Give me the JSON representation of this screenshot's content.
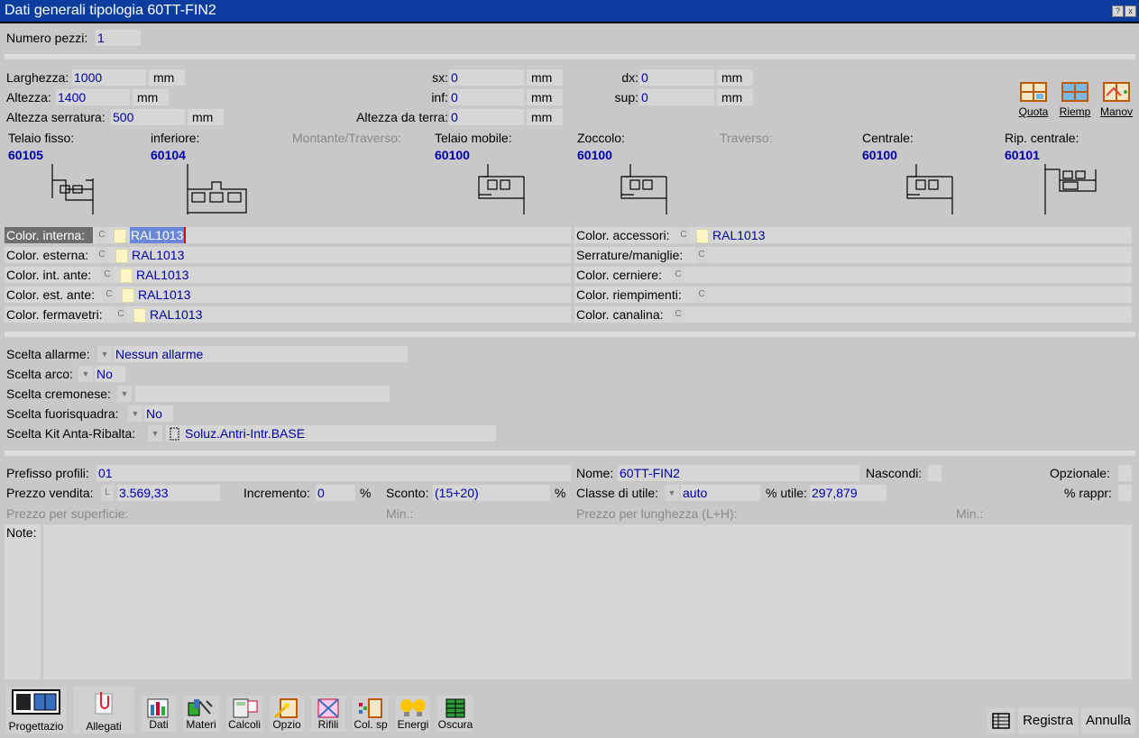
{
  "window": {
    "title": "Dati generali tipologia 60TT-FIN2",
    "help_btn": "?",
    "close_btn": "x"
  },
  "pezzi": {
    "label": "Numero pezzi:",
    "value": "1"
  },
  "dims": {
    "larghezza_label": "Larghezza:",
    "larghezza": "1000",
    "larghezza_unit": "mm",
    "altezza_label": "Altezza:",
    "altezza": "1400",
    "altezza_unit": "mm",
    "serratura_label": "Altezza serratura:",
    "serratura": "500",
    "serratura_unit": "mm",
    "sx_label": "sx:",
    "sx": "0",
    "sx_unit": "mm",
    "inf_label": "inf:",
    "inf": "0",
    "inf_unit": "mm",
    "terra_label": "Altezza da terra:",
    "terra": "0",
    "terra_unit": "mm",
    "dx_label": "dx:",
    "dx": "0",
    "dx_unit": "mm",
    "sup_label": "sup:",
    "sup": "0",
    "sup_unit": "mm"
  },
  "side_buttons": {
    "quota": "Quota",
    "riemp": "Riemp",
    "manov": "Manov"
  },
  "profiles": [
    {
      "label": "Telaio fisso:",
      "code": "60105",
      "enabled": true
    },
    {
      "label": "inferiore:",
      "code": "60104",
      "enabled": true
    },
    {
      "label": "Montante/Traverso:",
      "code": "",
      "enabled": false
    },
    {
      "label": "Telaio mobile:",
      "code": "60100",
      "enabled": true
    },
    {
      "label": "Zoccolo:",
      "code": "60100",
      "enabled": true
    },
    {
      "label": "Traverso:",
      "code": "",
      "enabled": false
    },
    {
      "label": "Centrale:",
      "code": "60100",
      "enabled": true
    },
    {
      "label": "Rip. centrale:",
      "code": "60101",
      "enabled": true
    }
  ],
  "colors_left": [
    {
      "label": "Color. interna:",
      "value": "RAL1013",
      "swatch": "#fbf6c4"
    },
    {
      "label": "Color. esterna:",
      "value": "RAL1013",
      "swatch": "#fbf6c4"
    },
    {
      "label": "Color. int. ante:",
      "value": "RAL1013",
      "swatch": "#fbf6c4"
    },
    {
      "label": "Color. est. ante:",
      "value": "RAL1013",
      "swatch": "#fbf6c4"
    },
    {
      "label": "Color. fermavetri:",
      "value": "RAL1013",
      "swatch": "#fbf6c4"
    }
  ],
  "colors_right": [
    {
      "label": "Color. accessori:",
      "value": "RAL1013"
    },
    {
      "label": "Serrature/maniglie:",
      "value": ""
    },
    {
      "label": "Color. cerniere:",
      "value": ""
    },
    {
      "label": "Color. riempimenti:",
      "value": ""
    },
    {
      "label": "Color. canalina:",
      "value": ""
    }
  ],
  "color_btn": "C",
  "choices": [
    {
      "label": "Scelta allarme:",
      "value": "Nessun allarme"
    },
    {
      "label": "Scelta arco:",
      "value": "No"
    },
    {
      "label": "Scelta cremonese:",
      "value": ""
    },
    {
      "label": "Scelta fuorisquadra:",
      "value": "No"
    },
    {
      "label": "Scelta Kit Anta-Ribalta:",
      "value": "Soluz.Antri-Intr.BASE"
    }
  ],
  "bottom": {
    "prefisso_label": "Prefisso profili:",
    "prefisso": "01",
    "nome_label": "Nome:",
    "nome": "60TT-FIN2",
    "nascondi_label": "Nascondi:",
    "opzionale_label": "Opzionale:",
    "prezzo_label": "Prezzo vendita:",
    "prezzo_btn": "L",
    "prezzo": "3.569,33",
    "incremento_label": "Incremento:",
    "incremento": "0",
    "incremento_unit": "%",
    "sconto_label": "Sconto:",
    "sconto": "(15+20)",
    "sconto_unit": "%",
    "classe_label": "Classe di utile:",
    "classe": "auto",
    "utile_label": "% utile:",
    "utile": "297,879",
    "rappr_label": "% rappr:",
    "superficie_label": "Prezzo per superficie:",
    "min_label": "Min.:",
    "lunghezza_label": "Prezzo per lunghezza (L+H):",
    "min2_label": "Min.:",
    "note_label": "Note:"
  },
  "toolbar": [
    "Progettazio",
    "Allegati",
    "Dati",
    "Materi",
    "Calcoli",
    "Opzio",
    "Rifili",
    "Col. sp",
    "Energi",
    "Oscura"
  ],
  "actions": {
    "registra": "Registra",
    "annulla": "Annulla"
  }
}
